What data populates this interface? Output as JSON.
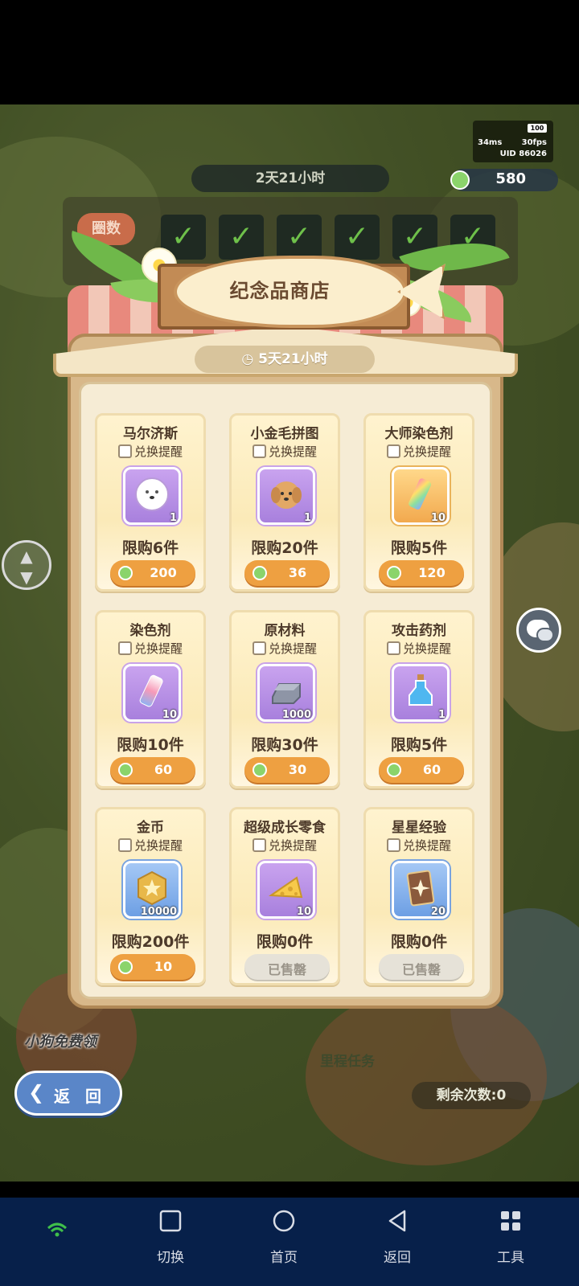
{
  "hud": {
    "battery": "100",
    "ping": "34ms",
    "fps": "30fps",
    "uid": "UID 86026",
    "currency": "580"
  },
  "background": {
    "event_timer": "2天21小时",
    "rounds_label": "圈数",
    "dog_label": "小狗免费领",
    "mileage_label": "里程任务",
    "remaining": "剩余次数:0"
  },
  "shop": {
    "title": "纪念品商店",
    "timer": "5天21小时",
    "remind_label": "兑换提醒",
    "items": [
      {
        "name": "马尔济斯",
        "qty": "1",
        "limit": "限购6件",
        "price": "200",
        "frame": "purple"
      },
      {
        "name": "小金毛拼图",
        "qty": "1",
        "limit": "限购20件",
        "price": "36",
        "frame": "purple"
      },
      {
        "name": "大师染色剂",
        "qty": "10",
        "limit": "限购5件",
        "price": "120",
        "frame": "gold"
      },
      {
        "name": "染色剂",
        "qty": "10",
        "limit": "限购10件",
        "price": "60",
        "frame": "purple"
      },
      {
        "name": "原材料",
        "qty": "1000",
        "limit": "限购30件",
        "price": "30",
        "frame": "purple"
      },
      {
        "name": "攻击药剂",
        "qty": "1",
        "limit": "限购5件",
        "price": "60",
        "frame": "purple"
      },
      {
        "name": "金币",
        "qty": "10000",
        "limit": "限购200件",
        "price": "10",
        "frame": "blue"
      },
      {
        "name": "超级成长零食",
        "qty": "10",
        "limit": "限购0件",
        "price": "已售罄",
        "frame": "purple"
      },
      {
        "name": "星星经验",
        "qty": "20",
        "limit": "限购0件",
        "price": "已售罄",
        "frame": "blue"
      }
    ]
  },
  "back_button": "返 回",
  "navbar": {
    "switch": "切换",
    "home": "首页",
    "back": "返回",
    "tools": "工具"
  },
  "colors": {
    "accent_orange": "#eea041",
    "coin_green": "#8bd46b",
    "navbar": "#07204a"
  }
}
